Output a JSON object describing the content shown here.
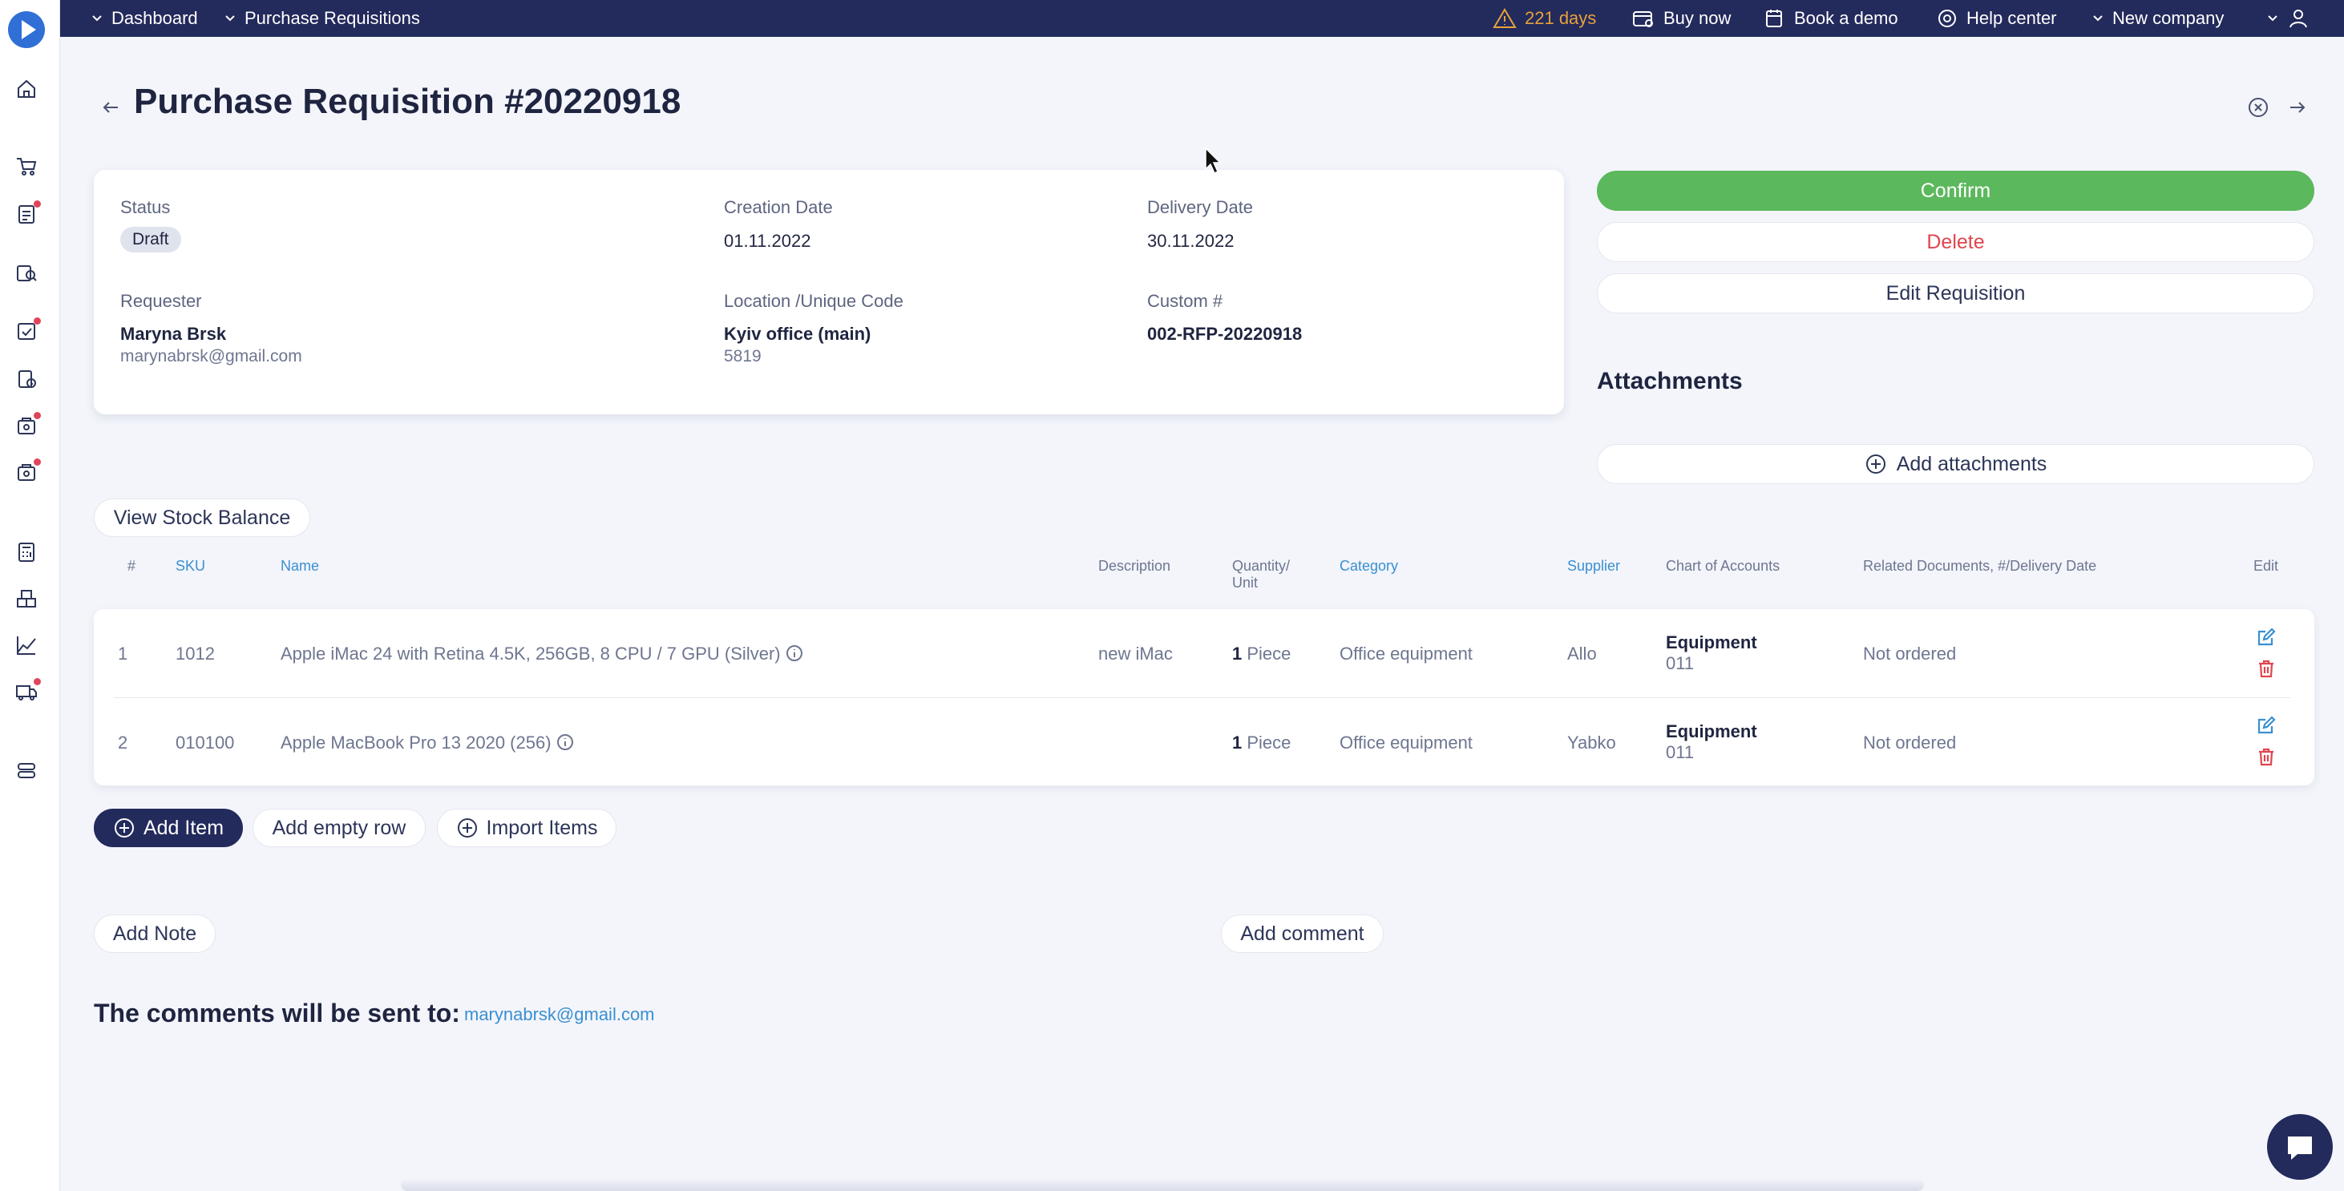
{
  "topbar": {
    "breadcrumb_1": "Dashboard",
    "breadcrumb_2": "Purchase Requisitions",
    "trial_warning": "221 days",
    "buy_now": "Buy now",
    "book_demo": "Book a demo",
    "help_center": "Help center",
    "company": "New company"
  },
  "header": {
    "title": "Purchase Requisition #20220918"
  },
  "details": {
    "status_label": "Status",
    "status_value": "Draft",
    "creation_date_label": "Creation Date",
    "creation_date_value": "01.11.2022",
    "delivery_date_label": "Delivery Date",
    "delivery_date_value": "30.11.2022",
    "requester_label": "Requester",
    "requester_name": "Maryna Brsk",
    "requester_email": "marynabrsk@gmail.com",
    "location_label": "Location /Unique Code",
    "location_value": "Kyiv office (main)",
    "location_code": "5819",
    "custom_label": "Custom #",
    "custom_value": "002-RFP-20220918"
  },
  "actions": {
    "confirm": "Confirm",
    "delete": "Delete",
    "edit": "Edit Requisition"
  },
  "attachments": {
    "title": "Attachments",
    "add": "Add attachments"
  },
  "stock_button": "View Stock Balance",
  "table": {
    "headers": {
      "num": "#",
      "sku": "SKU",
      "name": "Name",
      "description": "Description",
      "quantity_line1": "Quantity/",
      "quantity_line2": "Unit",
      "category": "Category",
      "supplier": "Supplier",
      "accounts": "Chart of Accounts",
      "related": "Related Documents, #/Delivery Date",
      "edit": "Edit"
    },
    "rows": [
      {
        "num": "1",
        "sku": "1012",
        "name": "Apple iMac 24 with Retina 4.5K, 256GB, 8 CPU / 7 GPU (Silver)",
        "description": "new iMac",
        "quantity": "1",
        "unit": "Piece",
        "category": "Office equipment",
        "supplier": "Allo",
        "account_name": "Equipment",
        "account_code": "011",
        "related": "Not ordered"
      },
      {
        "num": "2",
        "sku": "010100",
        "name": "Apple MacBook Pro 13 2020 (256)",
        "description": "",
        "quantity": "1",
        "unit": "Piece",
        "category": "Office equipment",
        "supplier": "Yabko",
        "account_name": "Equipment",
        "account_code": "011",
        "related": "Not ordered"
      }
    ]
  },
  "item_actions": {
    "add_item": "Add Item",
    "add_empty_row": "Add empty row",
    "import_items": "Import Items"
  },
  "notes": {
    "add_note": "Add Note",
    "add_comment": "Add comment"
  },
  "comments": {
    "title": "The comments will be sent to:",
    "email": "marynabrsk@gmail.com"
  },
  "colors": {
    "topbar": "#232a5c",
    "confirm": "#5cb85c",
    "danger": "#e0454f",
    "link": "#3a8fd1",
    "warning": "#e6a23a"
  }
}
